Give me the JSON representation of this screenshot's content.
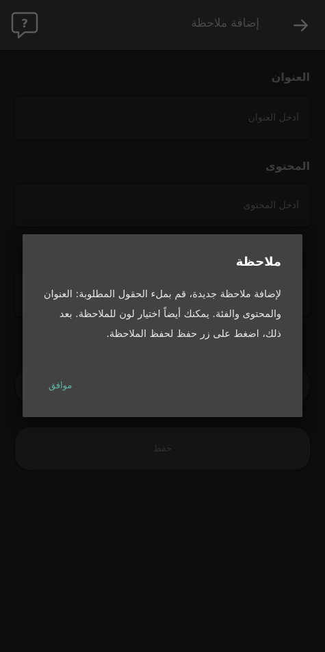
{
  "app_bar": {
    "title": "إضافة ملاحظة",
    "back_icon": "arrow-right-icon",
    "help_icon": "help-bubble-icon"
  },
  "form": {
    "title_label": "العنوان",
    "title_placeholder": "أدخل العنوان",
    "content_label": "المحتوى",
    "content_placeholder": "أدخل المحتوى",
    "save_label": "حفظ"
  },
  "dialog": {
    "title": "ملاحظة",
    "message": "لإضافة ملاحظة جديدة، قم بملء الحقول المطلوبة: العنوان والمحتوى والفئة. يمكنك أيضاً اختيار لون للملاحظة. بعد ذلك، اضغط على زر حفظ لحفظ الملاحظة.",
    "ok_label": "موافق"
  },
  "colors": {
    "background": "#151515",
    "app_bar": "#252525",
    "dialog": "#424242",
    "accent": "#5fb7a3"
  }
}
